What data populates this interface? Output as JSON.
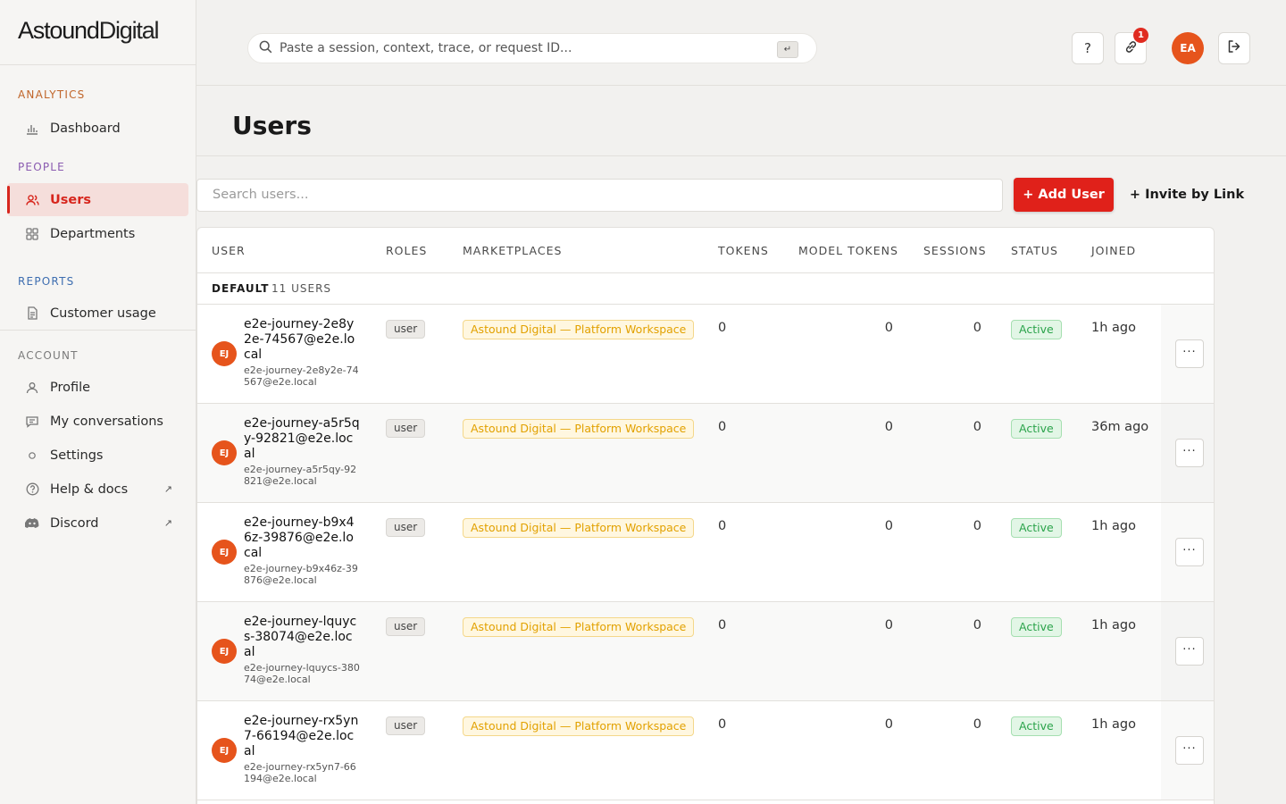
{
  "brand": {
    "part1": "Astound",
    "part2": "Digital"
  },
  "sidebar": {
    "sections": {
      "analytics": "ANALYTICS",
      "people": "PEOPLE",
      "reports": "REPORTS",
      "account": "ACCOUNT"
    },
    "items": {
      "dashboard": "Dashboard",
      "users": "Users",
      "departments": "Departments",
      "customer_usage": "Customer usage",
      "profile": "Profile",
      "my_conversations": "My conversations",
      "settings": "Settings",
      "help_docs": "Help & docs",
      "discord": "Discord"
    },
    "external_glyph": "↗"
  },
  "topbar": {
    "search_placeholder": "Paste a session, context, trace, or request ID...",
    "search_kbd": "↵",
    "help_label": "?",
    "links_badge": "1",
    "avatar_initials": "EA"
  },
  "page": {
    "title": "Users"
  },
  "controls": {
    "search_placeholder": "Search users...",
    "add_user": "+ Add User",
    "invite_link": "+ Invite by Link"
  },
  "table": {
    "headers": {
      "user": "USER",
      "roles": "ROLES",
      "marketplaces": "MARKETPLACES",
      "tokens": "TOKENS",
      "model_tokens": "MODEL TOKENS",
      "sessions": "SESSIONS",
      "status": "STATUS",
      "joined": "JOINED"
    },
    "group": {
      "name": "DEFAULT",
      "count": "11 USERS"
    },
    "rows": [
      {
        "initials": "EJ",
        "name": "e2e-journey-2e8y2e-74567@e2e.local",
        "email": "e2e-journey-2e8y2e-74567@e2e.local",
        "role": "user",
        "marketplace": "Astound Digital — Platform Workspace",
        "tokens": "0",
        "model_tokens": "0",
        "sessions": "0",
        "status": "Active",
        "joined": "1h ago",
        "more": "···"
      },
      {
        "initials": "EJ",
        "name": "e2e-journey-a5r5qy-92821@e2e.local",
        "email": "e2e-journey-a5r5qy-92821@e2e.local",
        "role": "user",
        "marketplace": "Astound Digital — Platform Workspace",
        "tokens": "0",
        "model_tokens": "0",
        "sessions": "0",
        "status": "Active",
        "joined": "36m ago",
        "more": "···"
      },
      {
        "initials": "EJ",
        "name": "e2e-journey-b9x46z-39876@e2e.local",
        "email": "e2e-journey-b9x46z-39876@e2e.local",
        "role": "user",
        "marketplace": "Astound Digital — Platform Workspace",
        "tokens": "0",
        "model_tokens": "0",
        "sessions": "0",
        "status": "Active",
        "joined": "1h ago",
        "more": "···"
      },
      {
        "initials": "EJ",
        "name": "e2e-journey-lquycs-38074@e2e.local",
        "email": "e2e-journey-lquycs-38074@e2e.local",
        "role": "user",
        "marketplace": "Astound Digital — Platform Workspace",
        "tokens": "0",
        "model_tokens": "0",
        "sessions": "0",
        "status": "Active",
        "joined": "1h ago",
        "more": "···"
      },
      {
        "initials": "EJ",
        "name": "e2e-journey-rx5yn7-66194@e2e.local",
        "email": "e2e-journey-rx5yn7-66194@e2e.local",
        "role": "user",
        "marketplace": "Astound Digital — Platform Workspace",
        "tokens": "0",
        "model_tokens": "0",
        "sessions": "0",
        "status": "Active",
        "joined": "1h ago",
        "more": "···"
      }
    ]
  },
  "colors": {
    "accent": "#e0211a",
    "avatar": "#e6541c",
    "status_active": "#2aa34a",
    "marketplace": "#e2a100"
  }
}
